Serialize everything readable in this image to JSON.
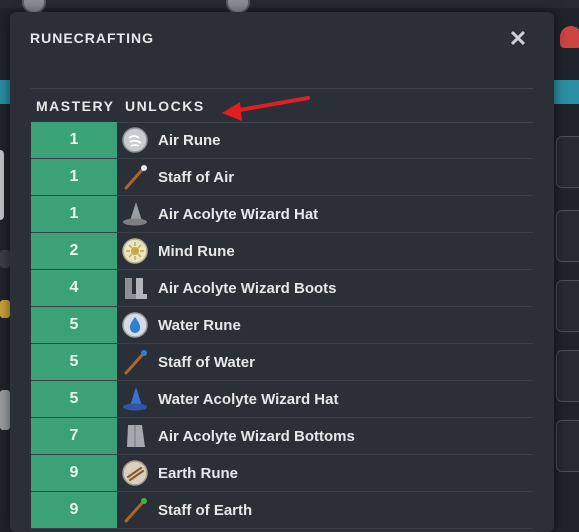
{
  "modal": {
    "title": "RUNECRAFTING",
    "close_glyph": "✕",
    "section_title": "MASTERY  UNLOCKS"
  },
  "unlocks": [
    {
      "level": "1",
      "name": "Air Rune",
      "icon": "air-rune-icon"
    },
    {
      "level": "1",
      "name": "Staff of Air",
      "icon": "staff-of-air-icon"
    },
    {
      "level": "1",
      "name": "Air Acolyte Wizard Hat",
      "icon": "wizard-hat-grey-icon"
    },
    {
      "level": "2",
      "name": "Mind Rune",
      "icon": "mind-rune-icon"
    },
    {
      "level": "4",
      "name": "Air Acolyte Wizard Boots",
      "icon": "wizard-boots-icon"
    },
    {
      "level": "5",
      "name": "Water Rune",
      "icon": "water-rune-icon"
    },
    {
      "level": "5",
      "name": "Staff of Water",
      "icon": "staff-of-water-icon"
    },
    {
      "level": "5",
      "name": "Water Acolyte Wizard Hat",
      "icon": "wizard-hat-blue-icon"
    },
    {
      "level": "7",
      "name": "Air Acolyte Wizard Bottoms",
      "icon": "wizard-bottoms-icon"
    },
    {
      "level": "9",
      "name": "Earth Rune",
      "icon": "earth-rune-icon"
    },
    {
      "level": "9",
      "name": "Staff of Earth",
      "icon": "staff-of-earth-icon"
    }
  ],
  "colors": {
    "level_cell": "#3aa276",
    "modal_bg": "#2b2f37",
    "arrow": "#e02020"
  }
}
